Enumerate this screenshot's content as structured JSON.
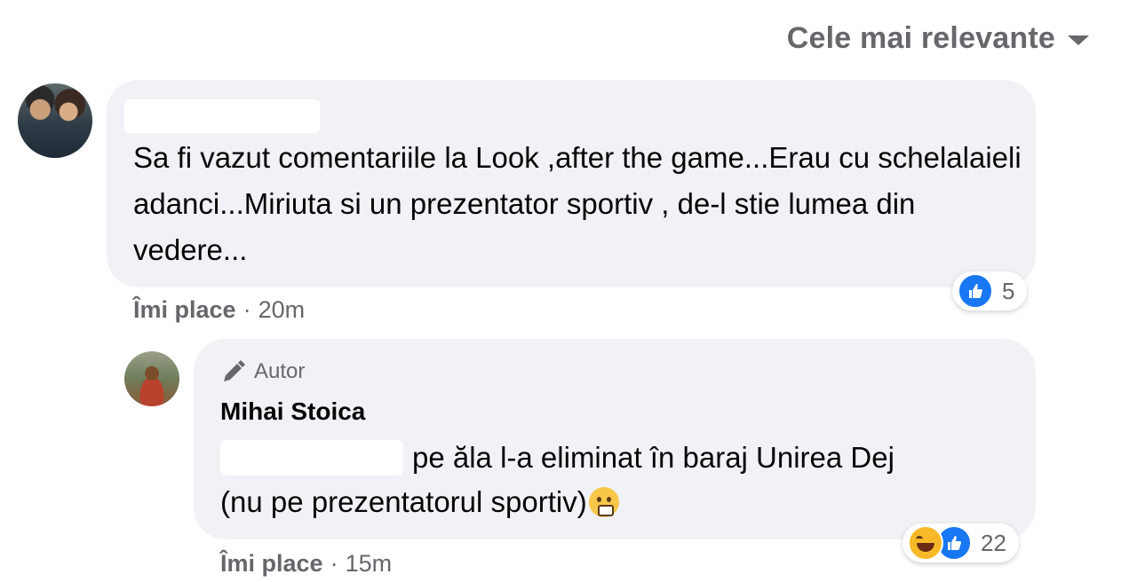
{
  "sort": {
    "label": "Cele mai relevante"
  },
  "comments": [
    {
      "text": "Sa fi vazut comentariile la Look ,after the game...Erau cu schelalaieli adanci...Miriuta si un prezentator sportiv , de-l stie lumea din vedere...",
      "actions": {
        "like": "Îmi place",
        "separator": "·",
        "time": "20m"
      },
      "reactions": {
        "types": [
          "like"
        ],
        "count": "5"
      }
    },
    {
      "badge": "Autor",
      "author": "Mihai Stoica",
      "text_line1": "pe ăla l-a eliminat în baraj Unirea Dej",
      "text_line2": "(nu pe prezentatorul sportiv)",
      "actions": {
        "like": "Îmi place",
        "separator": "·",
        "time": "15m"
      },
      "reactions": {
        "types": [
          "haha",
          "like"
        ],
        "count": "22"
      }
    }
  ],
  "colors": {
    "bubble": "#f0f2f5",
    "secondary_text": "#65676b",
    "like_blue": "#1877f2"
  }
}
